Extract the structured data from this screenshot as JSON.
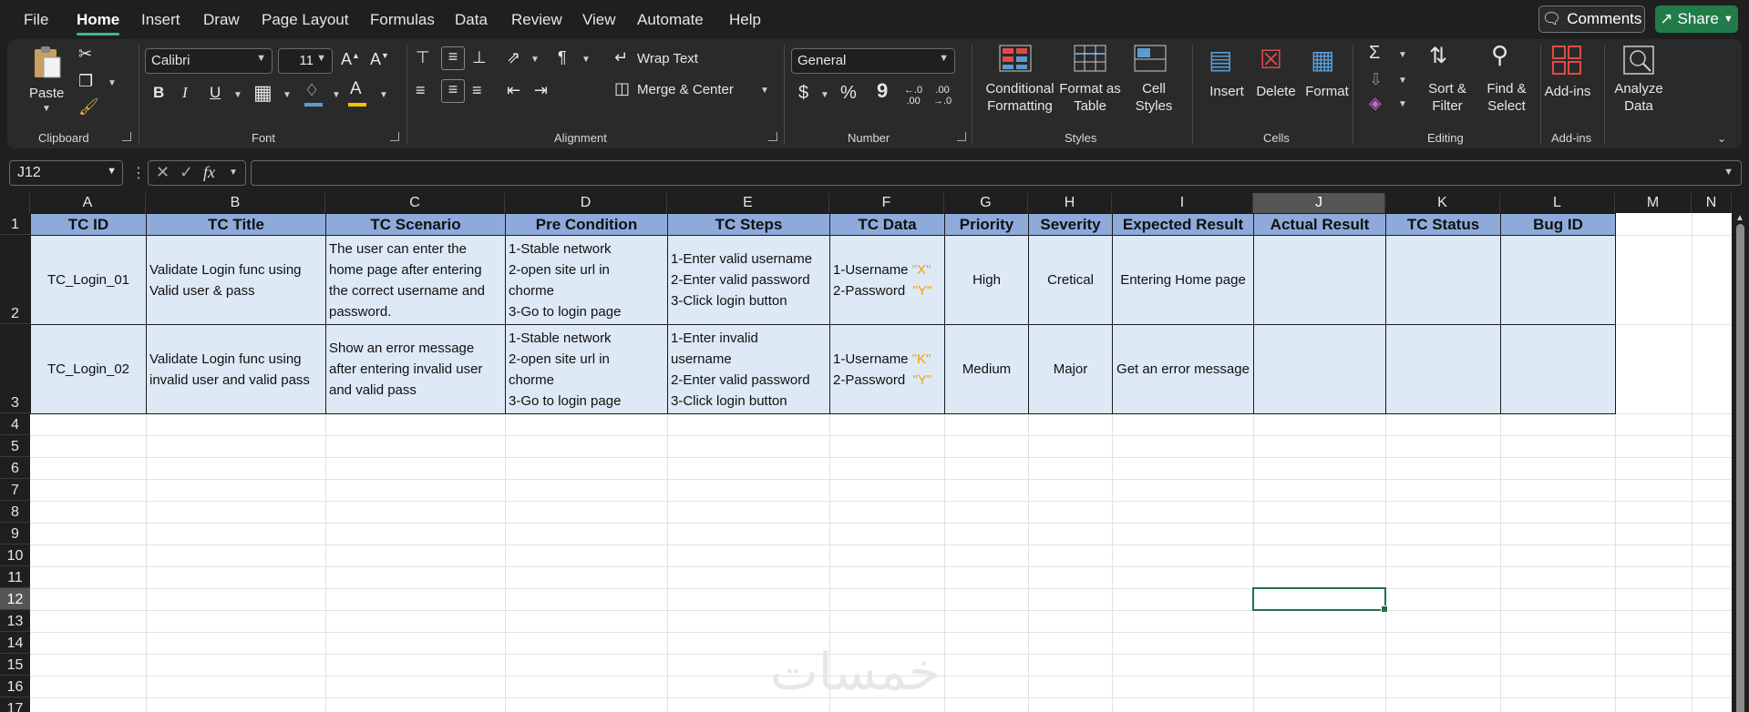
{
  "menu": {
    "tabs": [
      "File",
      "Home",
      "Insert",
      "Draw",
      "Page Layout",
      "Formulas",
      "Data",
      "Review",
      "View",
      "Automate",
      "Help"
    ],
    "active": "Home",
    "comments_label": "Comments",
    "share_label": "Share"
  },
  "ribbon": {
    "clipboard": {
      "label": "Clipboard",
      "paste": "Paste"
    },
    "font": {
      "label": "Font",
      "name": "Calibri",
      "size": "11",
      "bold": "B",
      "italic": "I",
      "underline": "U"
    },
    "alignment": {
      "label": "Alignment",
      "wrap_text": "Wrap Text",
      "merge_center": "Merge & Center"
    },
    "number": {
      "label": "Number",
      "format": "General",
      "currency": "$",
      "percent": "%",
      "comma": "9"
    },
    "styles": {
      "label": "Styles",
      "conditional": "Conditional\nFormatting",
      "format_table": "Format as\nTable",
      "cell_styles": "Cell\nStyles"
    },
    "cells": {
      "label": "Cells",
      "insert": "Insert",
      "delete": "Delete",
      "format": "Format"
    },
    "editing": {
      "label": "Editing",
      "sort_filter": "Sort &\nFilter",
      "find_select": "Find &\nSelect"
    },
    "addins": {
      "label": "Add-ins",
      "addins": "Add-ins",
      "analyze": "Analyze\nData"
    }
  },
  "formula_bar": {
    "name_box": "J12",
    "fx": "fx",
    "value": ""
  },
  "grid": {
    "columns": [
      "A",
      "B",
      "C",
      "D",
      "E",
      "F",
      "G",
      "H",
      "I",
      "J",
      "K",
      "L",
      "M",
      "N"
    ],
    "rows": [
      "1",
      "2",
      "3",
      "4",
      "5",
      "6",
      "7",
      "8",
      "9",
      "10",
      "11",
      "12",
      "13",
      "14",
      "15",
      "16",
      "17"
    ],
    "selected_column": "J",
    "selected_row": "12",
    "headers": [
      "TC ID",
      "TC Title",
      "TC Scenario",
      "Pre Condition",
      "TC Steps",
      "TC Data",
      "Priority",
      "Severity",
      "Expected Result",
      "Actual Result",
      "TC Status",
      "Bug ID"
    ],
    "records": [
      {
        "tc_id": "TC_Login_01",
        "title": "Validate Login func using\nValid user & pass",
        "scenario": "The user can enter the\nhome page after entering\nthe correct username and\npassword.",
        "precondition": "1-Stable network\n2-open site url in\nchorme\n3-Go to login page",
        "steps": "1-Enter valid username\n2-Enter valid password\n3-Click login button",
        "data_user_prefix": "1-Username ",
        "data_user_value": "\"X\"",
        "data_pass_prefix": "2-Password  ",
        "data_pass_value": "\"Y\"",
        "priority": "High",
        "severity": "Cretical",
        "expected": "Entering Home page",
        "actual": "",
        "status": "",
        "bug_id": ""
      },
      {
        "tc_id": "TC_Login_02",
        "title": "Validate Login func using\ninvalid user and valid pass",
        "scenario": "Show an error message\nafter entering invalid user\nand valid pass",
        "precondition": "1-Stable network\n2-open site url in\nchorme\n3-Go to login page",
        "steps": "1-Enter invalid\nusername\n2-Enter valid password\n3-Click login button",
        "data_user_prefix": "1-Username ",
        "data_user_value": "\"K\"",
        "data_pass_prefix": "2-Password  ",
        "data_pass_value": "\"Y\"",
        "priority": "Medium",
        "severity": "Major",
        "expected": "Get an error message",
        "actual": "",
        "status": "",
        "bug_id": ""
      }
    ]
  },
  "watermark": "خمسات",
  "colors": {
    "header_fill": "#8eaadb",
    "data_fill": "#dde9f5",
    "accent_green": "#217346",
    "share_green": "#217c4a",
    "highlight_yellow": "#f0a500"
  }
}
